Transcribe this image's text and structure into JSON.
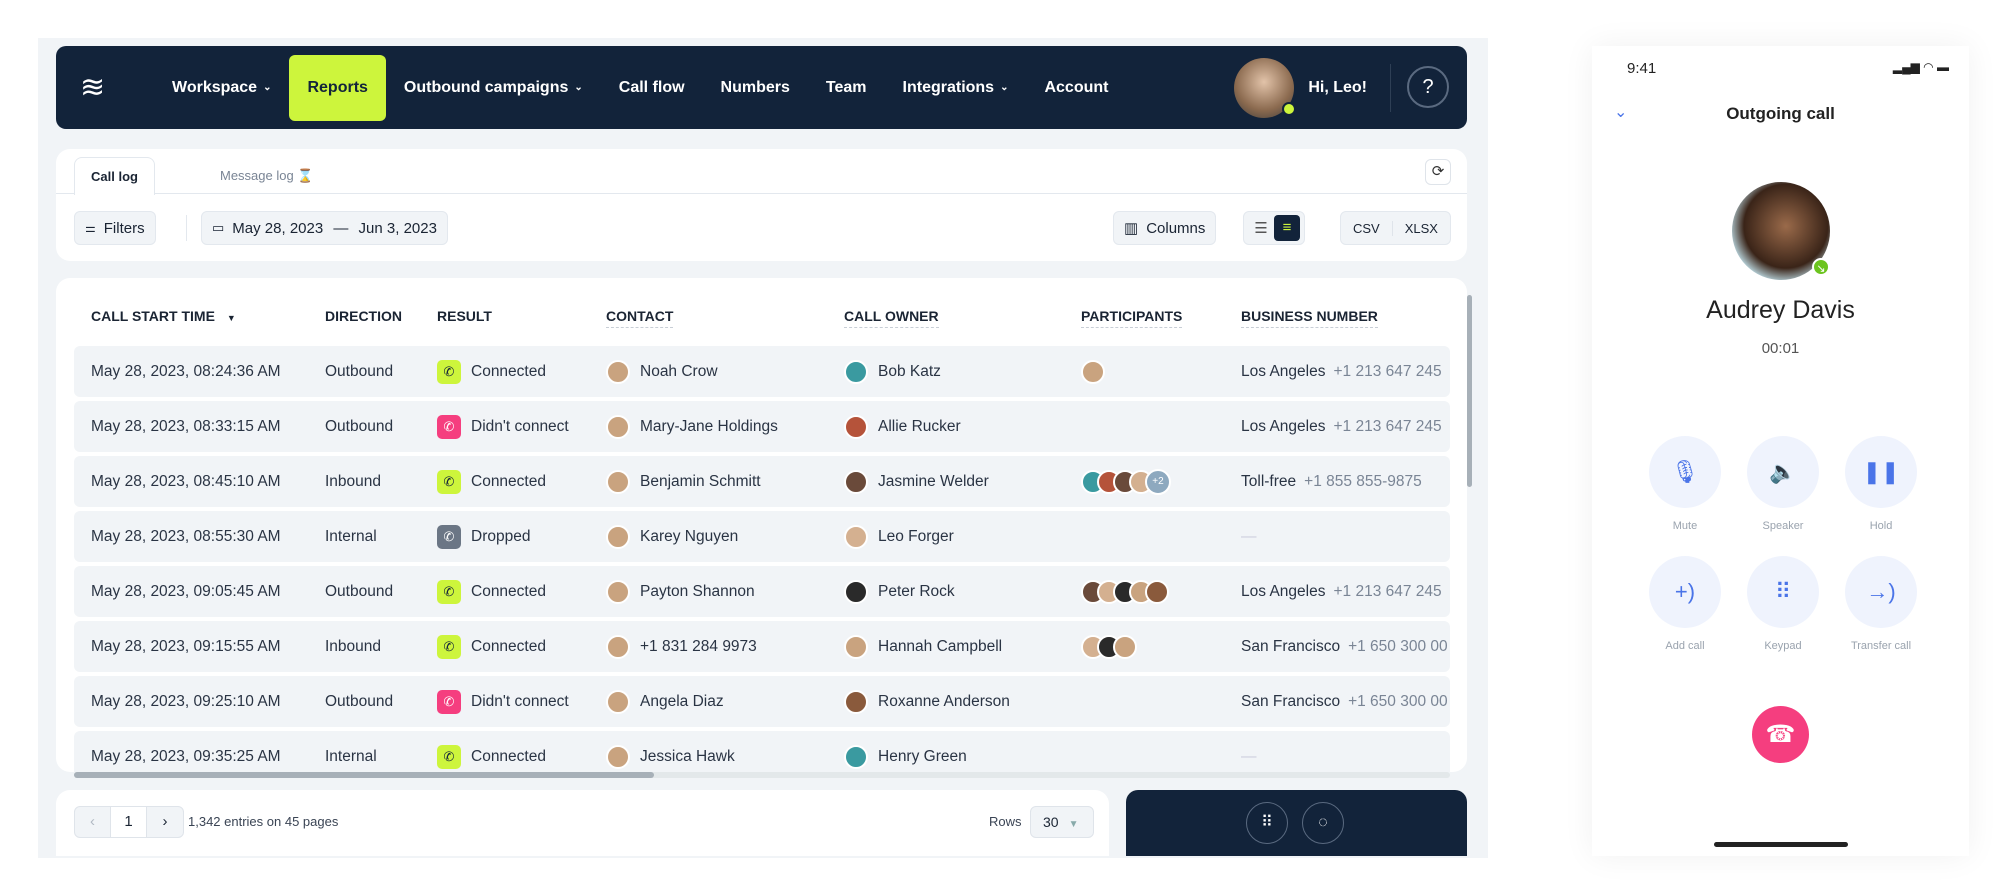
{
  "nav": {
    "items": [
      {
        "label": "Workspace",
        "dropdown": true
      },
      {
        "label": "Reports",
        "active": true
      },
      {
        "label": "Outbound campaigns",
        "dropdown": true
      },
      {
        "label": "Call flow"
      },
      {
        "label": "Numbers"
      },
      {
        "label": "Team"
      },
      {
        "label": "Integrations",
        "dropdown": true
      },
      {
        "label": "Account"
      }
    ],
    "greeting": "Hi, Leo!",
    "help": "?",
    "accent": "#cdf53c",
    "bg": "#12233a"
  },
  "tabs": {
    "call_log": "Call log",
    "message_log": "Message log"
  },
  "toolbar": {
    "filters": "Filters",
    "date_from": "May 28, 2023",
    "date_sep": "—",
    "date_to": "Jun 3, 2023",
    "columns": "Columns",
    "csv": "CSV",
    "xlsx": "XLSX"
  },
  "table": {
    "headers": [
      "CALL START TIME",
      "DIRECTION",
      "RESULT",
      "CONTACT",
      "CALL OWNER",
      "PARTICIPANTS",
      "BUSINESS NUMBER"
    ],
    "sort_indicator": "▼",
    "rows": [
      {
        "time": "May 28, 2023, 08:24:36 AM",
        "direction": "Outbound",
        "result": "Connected",
        "contact": "Noah Crow",
        "owner": "Bob Katz",
        "participants": 1,
        "more": "",
        "biz_name": "Los Angeles",
        "biz_num": "+1 213 647 245"
      },
      {
        "time": "May 28, 2023, 08:33:15 AM",
        "direction": "Outbound",
        "result": "Didn't connect",
        "contact": "Mary-Jane Holdings",
        "owner": "Allie Rucker",
        "participants": 0,
        "more": "",
        "biz_name": "Los Angeles",
        "biz_num": "+1 213 647 245"
      },
      {
        "time": "May 28, 2023, 08:45:10 AM",
        "direction": "Inbound",
        "result": "Connected",
        "contact": "Benjamin Schmitt",
        "owner": "Jasmine Welder",
        "participants": 4,
        "more": "+2",
        "biz_name": "Toll-free",
        "biz_num": "+1 855 855-9875"
      },
      {
        "time": "May 28, 2023, 08:55:30 AM",
        "direction": "Internal",
        "result": "Dropped",
        "contact": "Karey Nguyen",
        "owner": "Leo Forger",
        "participants": 0,
        "more": "",
        "biz_name": "—",
        "biz_num": ""
      },
      {
        "time": "May 28, 2023, 09:05:45 AM",
        "direction": "Outbound",
        "result": "Connected",
        "contact": "Payton Shannon",
        "owner": "Peter Rock",
        "participants": 5,
        "more": "",
        "biz_name": "Los Angeles",
        "biz_num": "+1 213 647 245"
      },
      {
        "time": "May 28, 2023, 09:15:55 AM",
        "direction": "Inbound",
        "result": "Connected",
        "contact": "+1 831 284 9973",
        "owner": "Hannah Campbell",
        "participants": 3,
        "more": "",
        "biz_name": "San Francisco",
        "biz_num": "+1 650 300 00"
      },
      {
        "time": "May 28, 2023, 09:25:10 AM",
        "direction": "Outbound",
        "result": "Didn't connect",
        "contact": "Angela Diaz",
        "owner": "Roxanne Anderson",
        "participants": 0,
        "more": "",
        "biz_name": "San Francisco",
        "biz_num": "+1 650 300 00"
      },
      {
        "time": "May 28, 2023, 09:35:25 AM",
        "direction": "Internal",
        "result": "Connected",
        "contact": "Jessica Hawk",
        "owner": "Henry Green",
        "participants": 0,
        "more": "",
        "biz_name": "—",
        "biz_num": ""
      }
    ],
    "result_colors": {
      "Connected": "#cdf53c",
      "Didn't connect": "#f53e7f",
      "Dropped": "#6b7685"
    }
  },
  "footer": {
    "prev": "‹",
    "page": "1",
    "next": "›",
    "entries": "1,342 entries on 45 pages",
    "rows_label": "Rows",
    "rows_value": "30"
  },
  "phone": {
    "time": "9:41",
    "title": "Outgoing call",
    "name": "Audrey Davis",
    "duration": "00:01",
    "controls": [
      {
        "label": "Mute",
        "icon": "mic-off-icon",
        "glyph": "🎙"
      },
      {
        "label": "Speaker",
        "icon": "speaker-icon",
        "glyph": "🔈"
      },
      {
        "label": "Hold",
        "icon": "pause-icon",
        "glyph": "❚❚"
      },
      {
        "label": "Add call",
        "icon": "add-call-icon",
        "glyph": "+)"
      },
      {
        "label": "Keypad",
        "icon": "keypad-icon",
        "glyph": "⠿"
      },
      {
        "label": "Transfer call",
        "icon": "transfer-call-icon",
        "glyph": "→)"
      }
    ],
    "hangup_color": "#f53e7f"
  }
}
